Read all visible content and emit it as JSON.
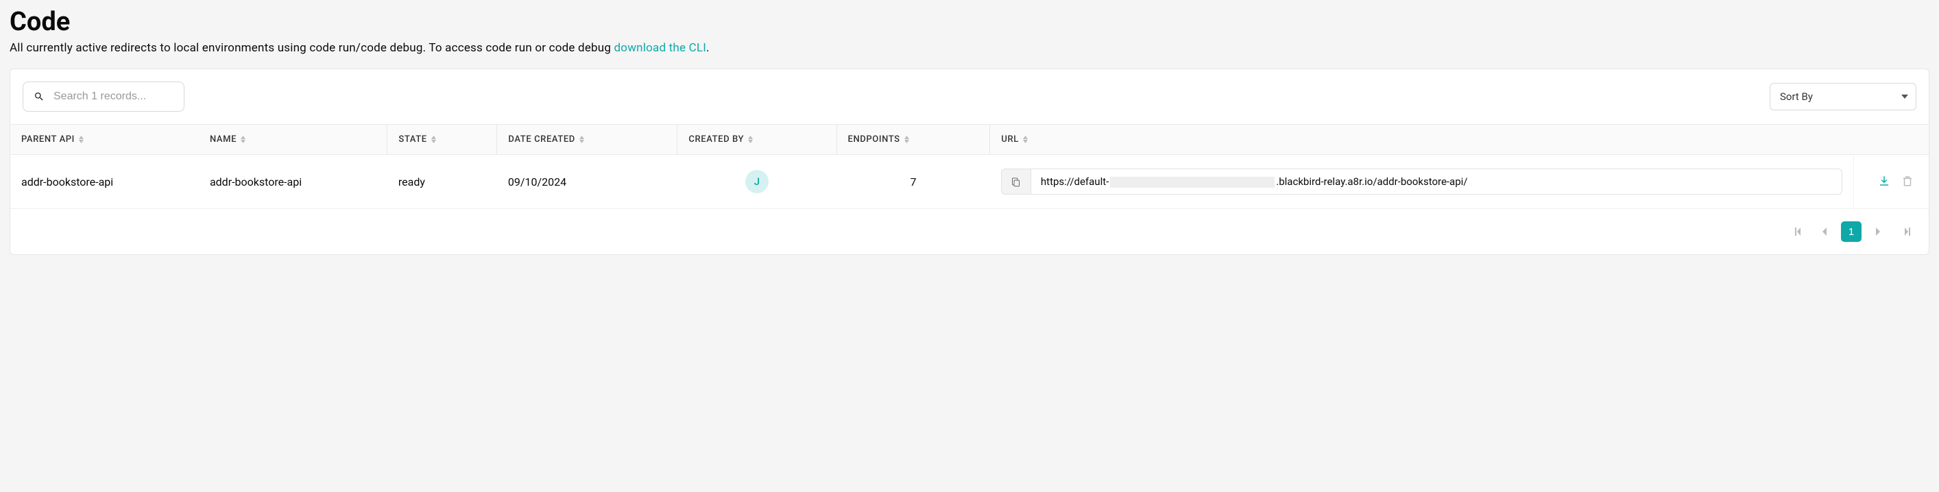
{
  "header": {
    "title": "Code",
    "subtitle_prefix": "All currently active redirects to local environments using code run/code debug. To access code run or code debug ",
    "subtitle_link": "download the CLI",
    "subtitle_suffix": "."
  },
  "toolbar": {
    "search_placeholder": "Search 1 records...",
    "sort_label": "Sort By"
  },
  "table": {
    "columns": {
      "parent_api": "PARENT API",
      "name": "NAME",
      "state": "STATE",
      "date_created": "DATE CREATED",
      "created_by": "CREATED BY",
      "endpoints": "ENDPOINTS",
      "url": "URL"
    },
    "rows": [
      {
        "parent_api": "addr-bookstore-api",
        "name": "addr-bookstore-api",
        "state": "ready",
        "date_created": "09/10/2024",
        "created_by_initial": "J",
        "endpoints": "7",
        "url_prefix": "https://default-",
        "url_suffix": ".blackbird-relay.a8r.io/addr-bookstore-api/"
      }
    ]
  },
  "pagination": {
    "current": "1"
  }
}
